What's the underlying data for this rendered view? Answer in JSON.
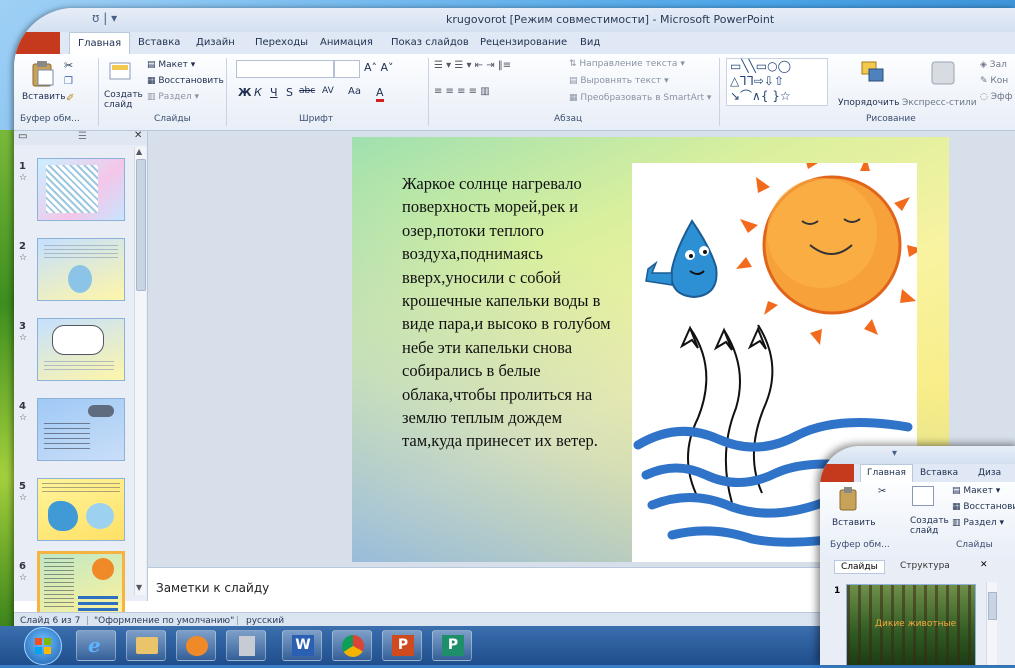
{
  "window": {
    "title": "krugovorot [Режим совместимости] - Microsoft PowerPoint",
    "quick_access": "ʊ | ▾"
  },
  "tabs": [
    "Главная",
    "Вставка",
    "Дизайн",
    "Переходы",
    "Анимация",
    "Показ слайдов",
    "Рецензирование",
    "Вид"
  ],
  "ribbon": {
    "clipboard": {
      "paste": "Вставить",
      "group": "Буфер обм..."
    },
    "slides": {
      "new_slide": "Создать\nслайд",
      "layout": "Макет",
      "reset": "Восстановить",
      "section": "Раздел",
      "group": "Слайды"
    },
    "font": {
      "group": "Шрифт",
      "bold": "Ж",
      "italic": "К",
      "underline": "Ч",
      "strike": "S",
      "abc": "abc",
      "spacing": "AV",
      "case": "Aa",
      "color": "A"
    },
    "paragraph": {
      "group": "Абзац",
      "text_direction": "Направление текста",
      "align_text": "Выровнять текст",
      "smartart": "Преобразовать в SmartArt"
    },
    "drawing": {
      "group": "Рисование",
      "arrange": "Упорядочить",
      "quick_styles": "Экспресс-стили",
      "fill": "Зал",
      "outline": "Кон",
      "effects": "Эфф"
    }
  },
  "slide_numbers": [
    "1",
    "2",
    "3",
    "4",
    "5",
    "6"
  ],
  "slide_text": "Жаркое солнце нагревало поверхность морей,рек и озер,потоки теплого воздуха,поднимаясь вверх,уносили с собой крошечные капельки воды в виде пара,и высоко в голубом небе эти капельки снова собирались в белые облака,чтобы пролиться на землю теплым дождем там,куда принесет их ветер.",
  "notes_placeholder": "Заметки к слайду",
  "status": {
    "slide": "Слайд 6 из 7",
    "theme": "\"Оформление по умолчанию\"",
    "lang": "русский"
  },
  "second_window": {
    "tabs": [
      "Главная",
      "Вставка",
      "Диза"
    ],
    "paste": "Вставить",
    "new_slide": "Создать\nслайд",
    "layout": "Макет",
    "reset": "Восстановить",
    "section": "Раздел",
    "clip_group": "Буфер обм...",
    "slides_group": "Слайды",
    "pane_tabs": [
      "Слайды",
      "Структура"
    ],
    "thumb_number": "1",
    "thumb_text": "Дикие животные"
  }
}
